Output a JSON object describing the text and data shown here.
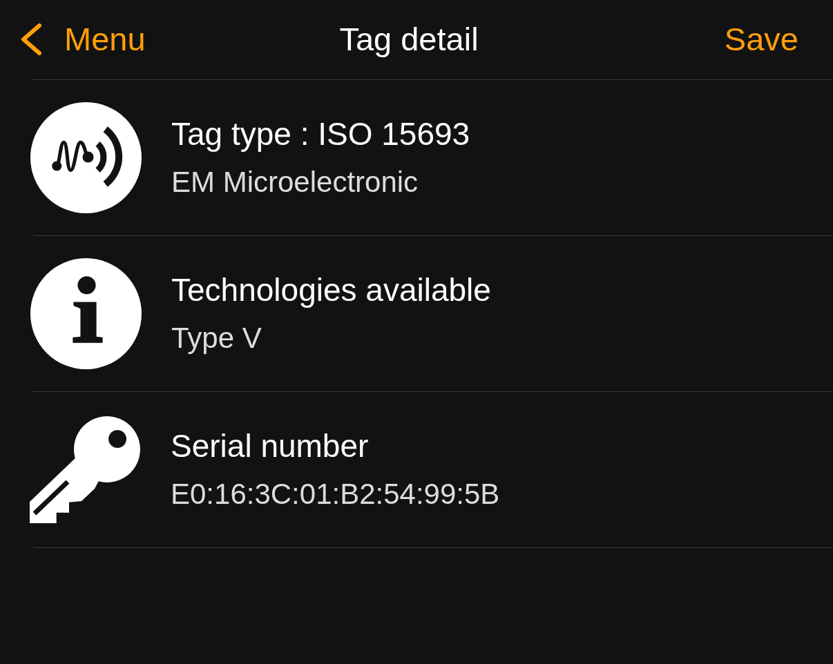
{
  "nav": {
    "back_label": "Menu",
    "title": "Tag detail",
    "action": "Save"
  },
  "rows": [
    {
      "kind": "tag",
      "title": "Tag type : ISO 15693",
      "subtitle": "EM Microelectronic"
    },
    {
      "kind": "info",
      "title": "Technologies available",
      "subtitle": "Type V"
    },
    {
      "kind": "key",
      "title": "Serial number",
      "subtitle": "E0:16:3C:01:B2:54:99:5B"
    }
  ]
}
